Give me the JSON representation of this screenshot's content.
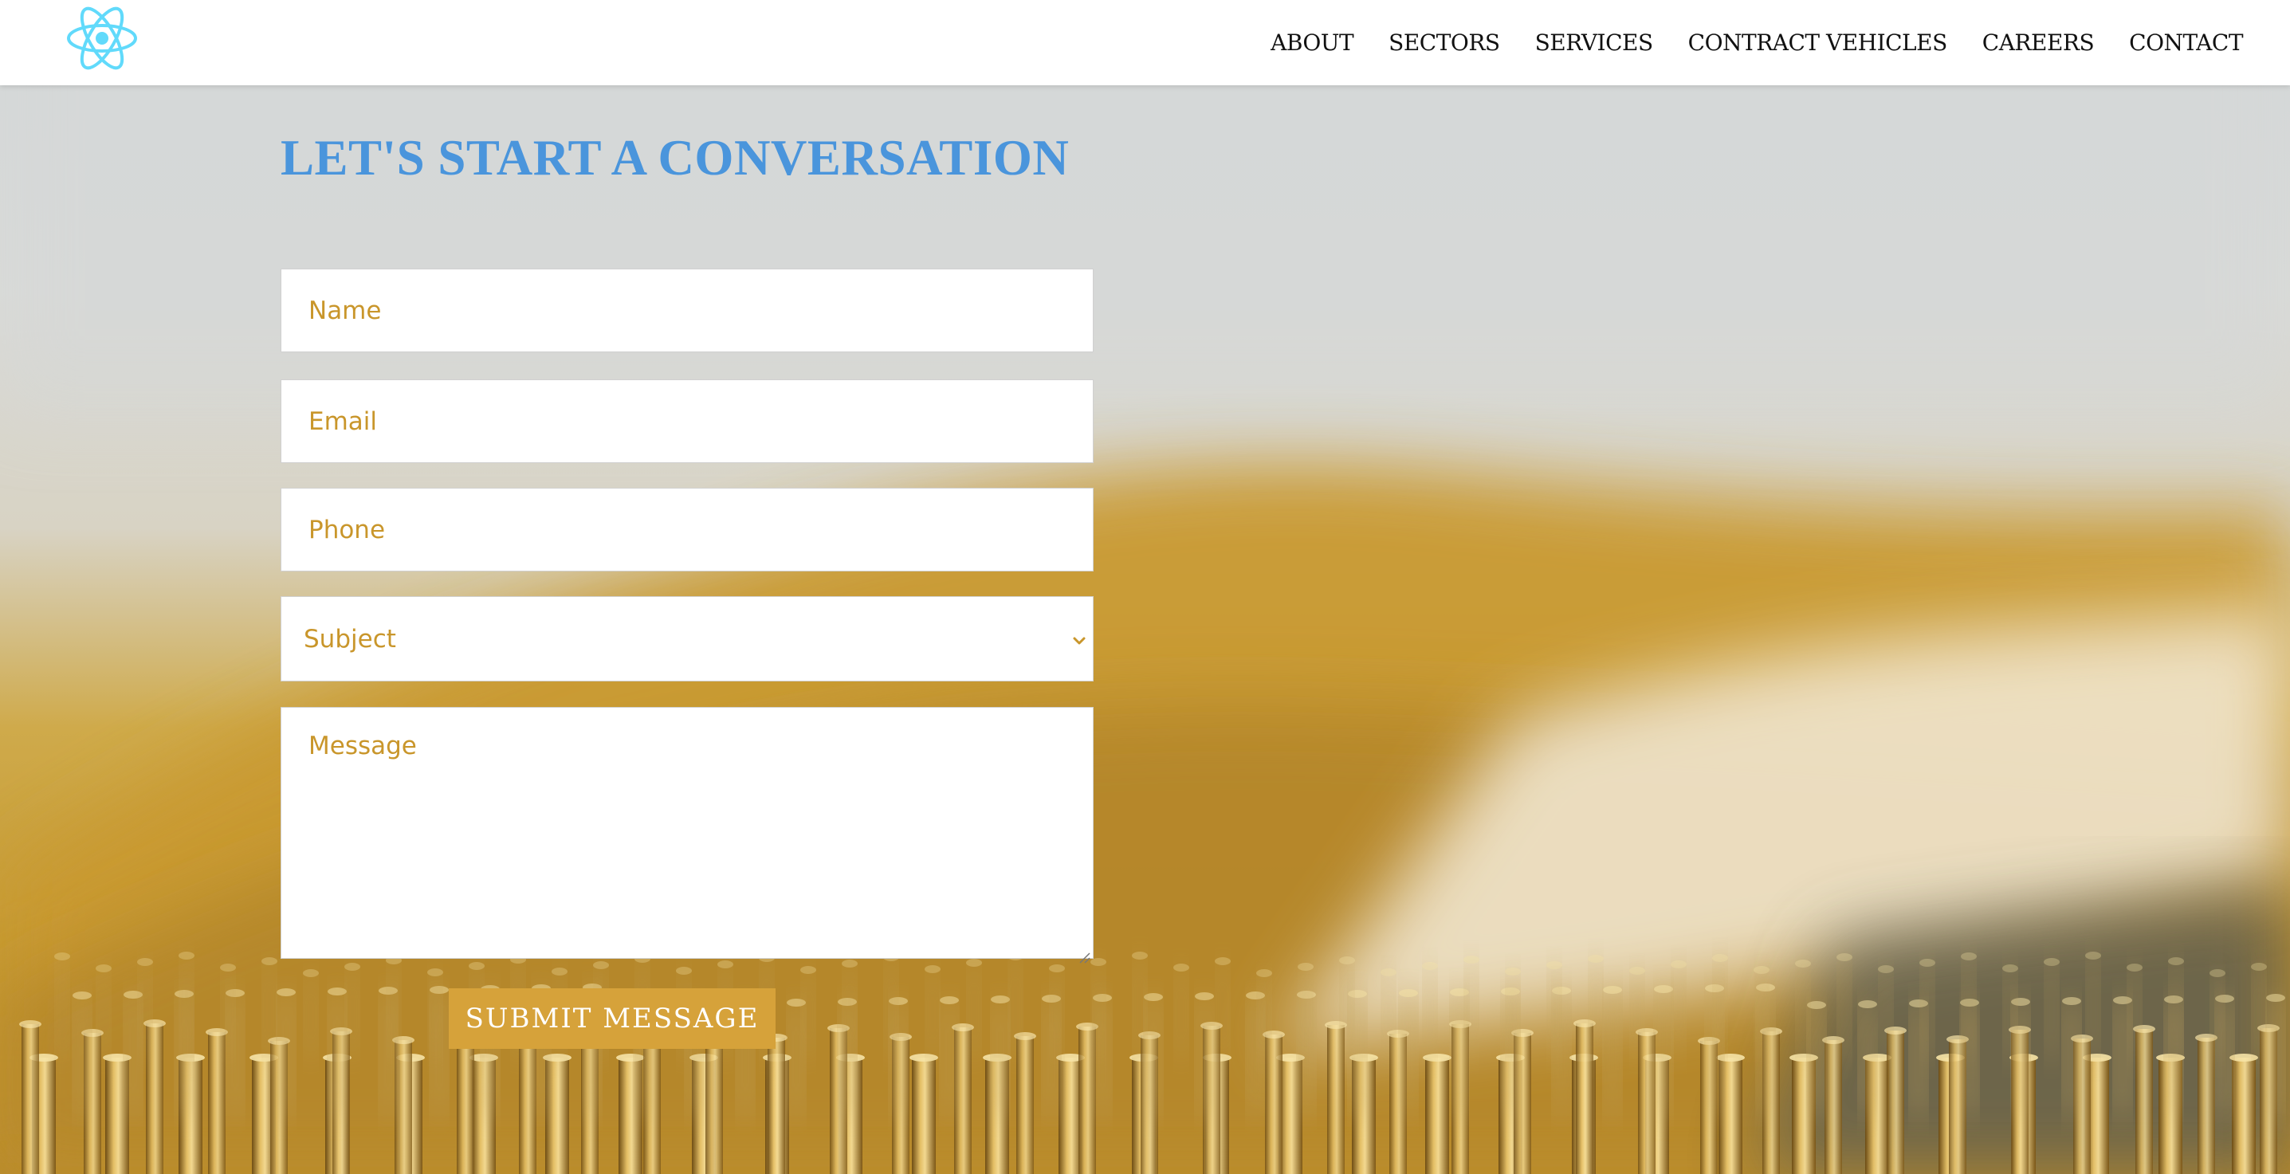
{
  "header": {
    "logo": "react-atom-logo",
    "nav": [
      {
        "label": "ABOUT"
      },
      {
        "label": "SECTORS"
      },
      {
        "label": "SERVICES"
      },
      {
        "label": "CONTRACT VEHICLES"
      },
      {
        "label": "CAREERS"
      },
      {
        "label": "CONTACT"
      }
    ]
  },
  "main": {
    "heading": "LET'S START A CONVERSATION",
    "form": {
      "name_placeholder": "Name",
      "email_placeholder": "Email",
      "phone_placeholder": "Phone",
      "subject_selected": "Subject",
      "message_placeholder": "Message",
      "submit_label": "SUBMIT MESSAGE"
    }
  },
  "colors": {
    "heading": "#4a95dc",
    "placeholder_text": "#c9962b",
    "submit_button": "#d6a23a",
    "logo": "#61dafb"
  }
}
